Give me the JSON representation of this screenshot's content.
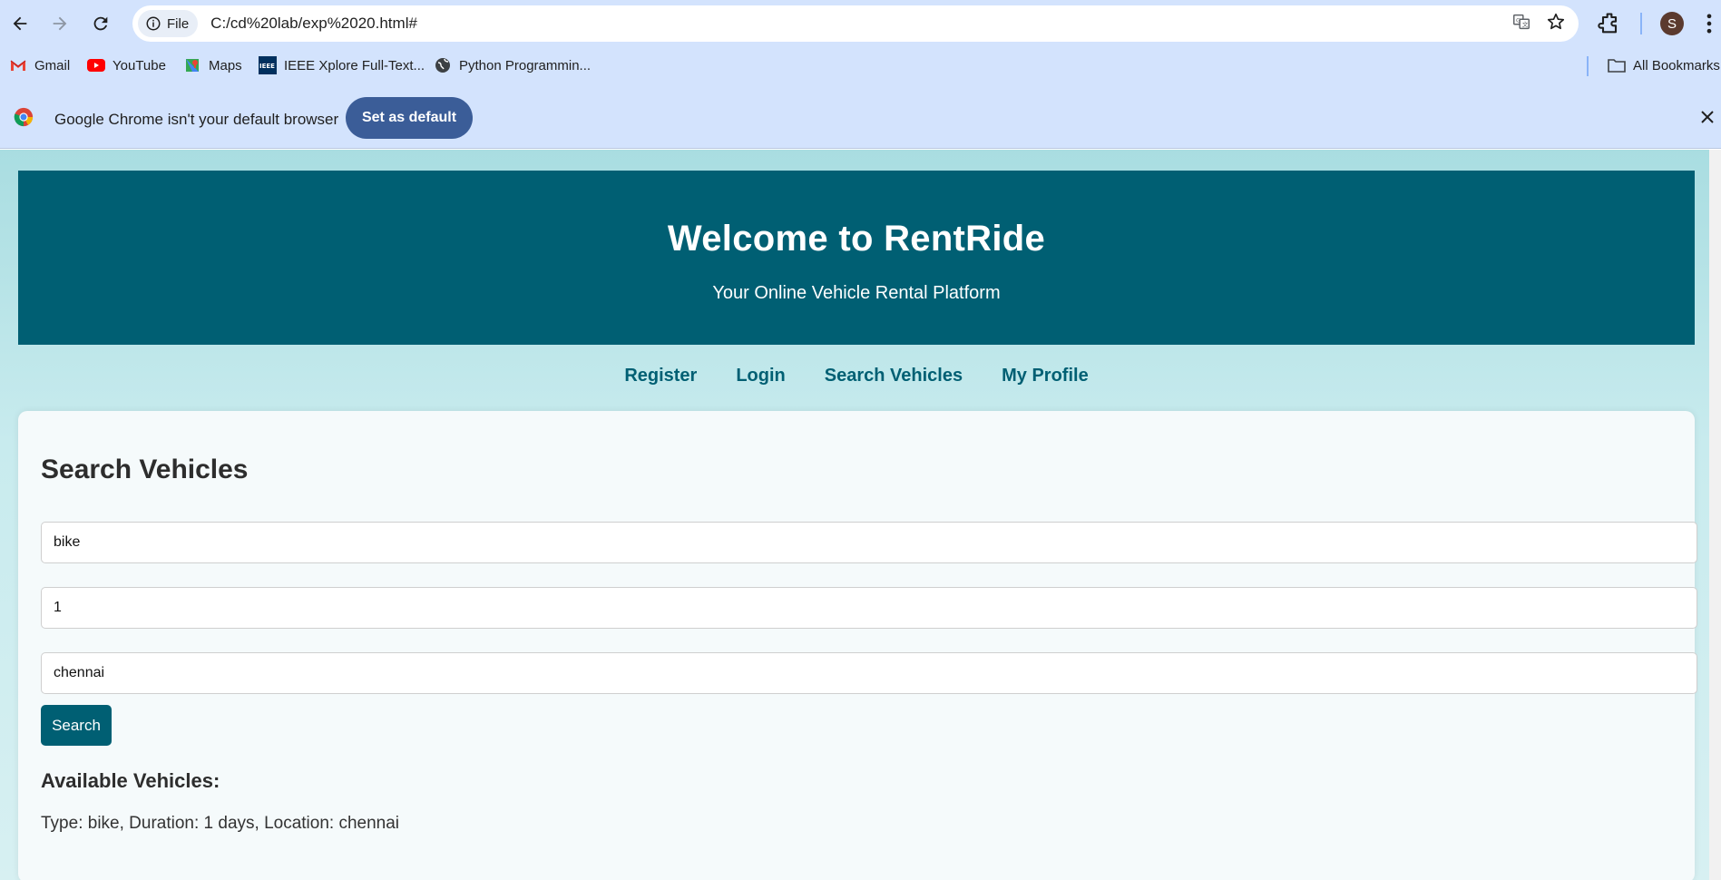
{
  "browser": {
    "url": "C:/cd%20lab/exp%2020.html#",
    "chip_label": "File",
    "avatar_initial": "S",
    "bookmarks": [
      {
        "label": "Gmail",
        "icon": "gmail-icon"
      },
      {
        "label": "YouTube",
        "icon": "youtube-icon"
      },
      {
        "label": "Maps",
        "icon": "maps-icon"
      },
      {
        "label": "IEEE Xplore Full-Text...",
        "icon": "ieee-icon"
      },
      {
        "label": "Python Programmin...",
        "icon": "globe-icon"
      }
    ],
    "all_bookmarks": "All Bookmarks",
    "infobar": {
      "message": "Google Chrome isn't your default browser",
      "button": "Set as default"
    },
    "colors": {
      "toolbar": "#d3e3fd",
      "infobar_button": "#3b5d98"
    }
  },
  "page": {
    "header": {
      "title": "Welcome to RentRide",
      "subtitle": "Your Online Vehicle Rental Platform"
    },
    "nav": [
      "Register",
      "Login",
      "Search Vehicles",
      "My Profile"
    ],
    "search": {
      "title": "Search Vehicles",
      "vehicle_type_value": "bike",
      "duration_value": "1",
      "location_value": "chennai",
      "button": "Search"
    },
    "results": {
      "heading": "Available Vehicles:",
      "items": [
        "Type: bike, Duration: 1 days, Location: chennai"
      ]
    },
    "colors": {
      "primary": "#005f73",
      "background": "#c8ebee"
    }
  }
}
